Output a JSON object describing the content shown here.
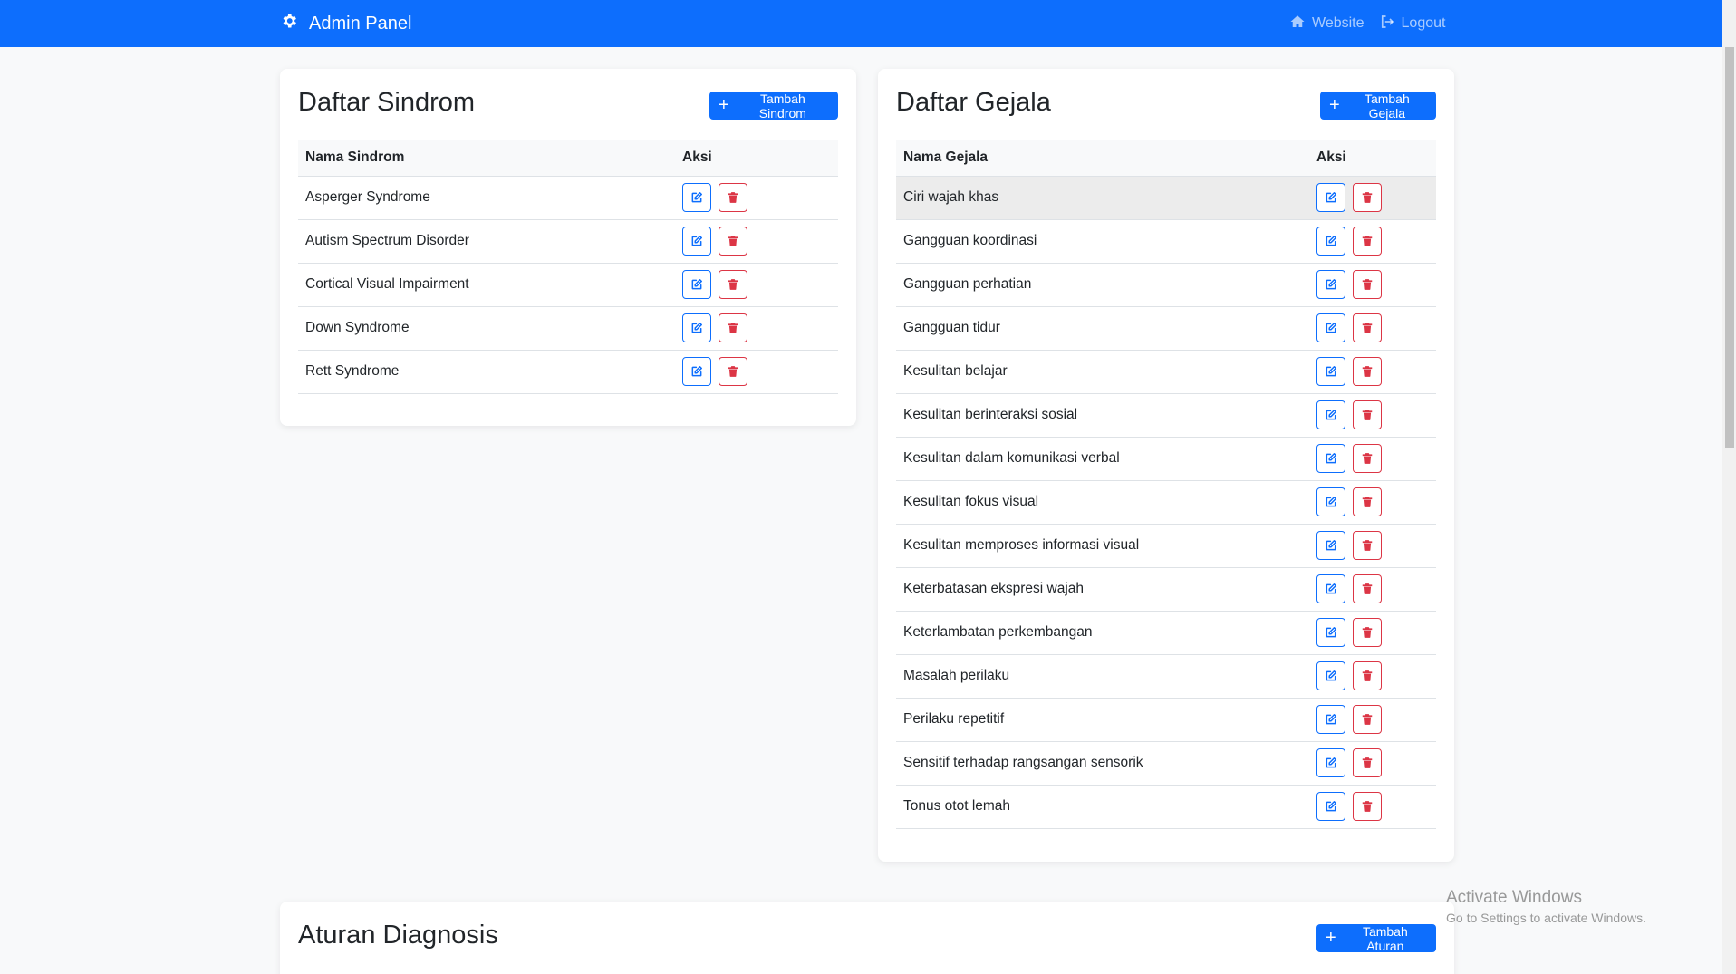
{
  "navbar": {
    "brand": "Admin Panel",
    "brand_icon": "gear-icon",
    "website_label": "Website",
    "logout_label": "Logout",
    "bg_color": "#0d6efd"
  },
  "sindrom": {
    "title": "Daftar Sindrom",
    "add_label": "Tambah Sindrom",
    "col_name": "Nama Sindrom",
    "col_action": "Aksi",
    "rows": [
      "Asperger Syndrome",
      "Autism Spectrum Disorder",
      "Cortical Visual Impairment",
      "Down Syndrome",
      "Rett Syndrome"
    ]
  },
  "gejala": {
    "title": "Daftar Gejala",
    "add_label": "Tambah Gejala",
    "col_name": "Nama Gejala",
    "col_action": "Aksi",
    "rows": [
      "Ciri wajah khas",
      "Gangguan koordinasi",
      "Gangguan perhatian",
      "Gangguan tidur",
      "Kesulitan belajar",
      "Kesulitan berinteraksi sosial",
      "Kesulitan dalam komunikasi verbal",
      "Kesulitan fokus visual",
      "Kesulitan memproses informasi visual",
      "Keterbatasan ekspresi wajah",
      "Keterlambatan perkembangan",
      "Masalah perilaku",
      "Perilaku repetitif",
      "Sensitif terhadap rangsangan sensorik",
      "Tonus otot lemah"
    ]
  },
  "aturan": {
    "title": "Aturan Diagnosis",
    "add_label": "Tambah Aturan"
  },
  "watermark": {
    "line1": "Activate Windows",
    "line2": "Go to Settings to activate Windows."
  },
  "colors": {
    "primary": "#0d6efd",
    "danger": "#dc3545"
  }
}
